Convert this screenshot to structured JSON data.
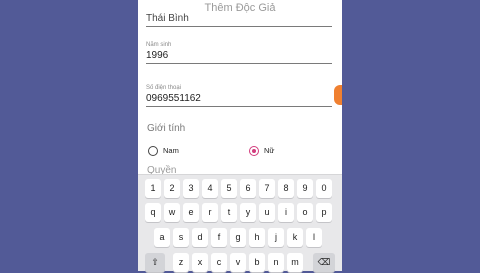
{
  "colors": {
    "background": "#525a97",
    "accent": "#d23c7d",
    "side_tab": "#f08030"
  },
  "form": {
    "title": "Thêm Độc Giả",
    "address_value": "Thái Bình",
    "birth_year_label": "Năm sinh",
    "birth_year_value": "1996",
    "phone_label": "Số điện thoại",
    "phone_value": "0969551162",
    "gender_label": "Giới tính",
    "gender_options": [
      {
        "label": "Nam",
        "selected": false
      },
      {
        "label": "Nữ",
        "selected": true
      }
    ],
    "rights_label": "Quyền"
  },
  "keyboard": {
    "rows": [
      [
        "1",
        "2",
        "3",
        "4",
        "5",
        "6",
        "7",
        "8",
        "9",
        "0"
      ],
      [
        "q",
        "w",
        "e",
        "r",
        "t",
        "y",
        "u",
        "i",
        "o",
        "p"
      ],
      [
        "a",
        "s",
        "d",
        "f",
        "g",
        "h",
        "j",
        "k",
        "l"
      ],
      [
        "⇧",
        "z",
        "x",
        "c",
        "v",
        "b",
        "n",
        "m",
        "⌫"
      ]
    ]
  }
}
